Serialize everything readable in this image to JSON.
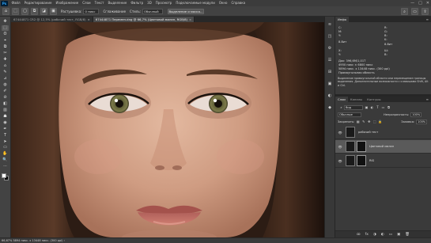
{
  "menubar": {
    "logo": "Ps",
    "items": [
      "Файл",
      "Редактирование",
      "Изображение",
      "Слои",
      "Текст",
      "Выделение",
      "Фильтр",
      "3D",
      "Просмотр",
      "Подключаемые модули",
      "Окно",
      "Справка"
    ],
    "controls": [
      "—",
      "□",
      "✕"
    ]
  },
  "optionsbar": {
    "feather_label": "Растушевка:",
    "feather_value": "0 пикс",
    "smoothing_label": "Сглаживание",
    "style_label": "Стиль:",
    "style_value": "Обычный",
    "select_mask_button": "Выделение и маска..."
  },
  "tabs": [
    {
      "label": "67444871 CR2 @ 12,5% (рабочий тест, RGB/8)",
      "active": false
    },
    {
      "label": "67444871 Перемен.dng @ 66,7% (Цветовой милан, RGB/8)",
      "active": true
    }
  ],
  "tools": [
    "✥",
    "⬚",
    "ʘ",
    "⌖",
    "⧉",
    "✂",
    "✚",
    "⌂",
    "✎",
    "⊿",
    "◍",
    "✐",
    "⊘",
    "◧",
    "▥",
    "☗",
    "◉",
    "✒",
    "T",
    "➤",
    "▭",
    "✋",
    "🔍",
    "···"
  ],
  "strip_icons": [
    "≋",
    "◳",
    "⚙",
    "☰",
    "⊞",
    "▣",
    "◐",
    "◆"
  ],
  "info_panel": {
    "tab": "Инфо",
    "menu": "≡",
    "r_label": "R:",
    "g_label": "G:",
    "b_label": "B:",
    "c_label": "C:",
    "m_label": "M:",
    "y_label": "Y:",
    "k_label": "K:",
    "x_label": "X:",
    "y2_label": "Y:",
    "w_label": "Ш:",
    "h_label": "В:",
    "bit8a": "8-бит",
    "bit8b": "8-бит",
    "doc_line1": "Док: 396,6M/1,01T",
    "doc_line2": "4950 пикс × 6800 пикс",
    "doc_line3": "5894 пикс. x 13448 пикс. (300 ppi)",
    "doc_line4": "Прямоугольная область",
    "desc": "Выделение прямоугольной области или перемещение границы выделения. Дополнительные возможности с клавишами Shift, Alt и Ctrl."
  },
  "layers_panel": {
    "tabs": [
      "Слои",
      "Каналы",
      "Контуры"
    ],
    "active_tab": "Слои",
    "menu": "≡",
    "search_placeholder": "Вид",
    "blend_mode": "Обычные",
    "opacity_label": "Непрозрачность:",
    "opacity_value": "100%",
    "lock_label": "Закрепить:",
    "fill_label": "Заливка:",
    "fill_value": "100%",
    "layers": [
      {
        "name": "рабочий тест",
        "selected": false
      },
      {
        "name": "Цветовой милан",
        "selected": true
      },
      {
        "name": "RIG",
        "selected": false
      }
    ],
    "bottom_icons": [
      "ꝏ",
      "fx",
      "◑",
      "◐",
      "▭",
      "▣",
      "🗑"
    ]
  },
  "statusbar": {
    "text": "66,67%   5894 пикс. х 13448 пикс. (300 ppi)   ›"
  }
}
